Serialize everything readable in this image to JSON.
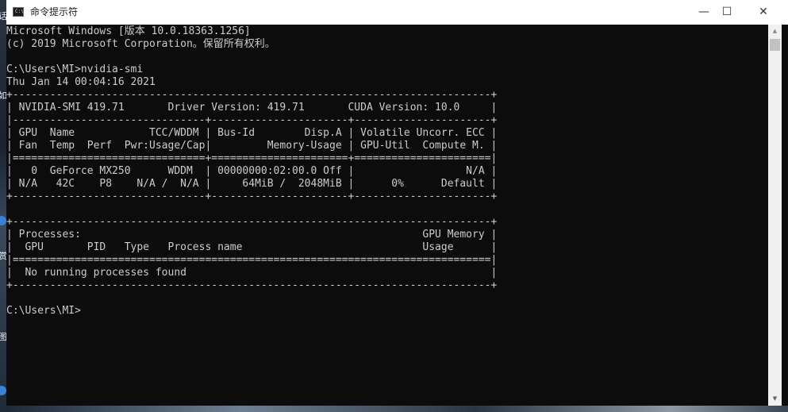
{
  "window": {
    "title": "命令提示符",
    "icon": "cmd-icon",
    "icon_glyph": "C:\\_",
    "controls": {
      "minimize": "—",
      "maximize": "☐",
      "close": "✕"
    }
  },
  "desktop": {
    "glyphs": [
      "话",
      "如",
      "赏",
      "图"
    ]
  },
  "terminal": {
    "lines": [
      "Microsoft Windows [版本 10.0.18363.1256]",
      "(c) 2019 Microsoft Corporation。保留所有权利。",
      "",
      "C:\\Users\\MI>nvidia-smi",
      "Thu Jan 14 00:04:16 2021",
      "+-----------------------------------------------------------------------------+",
      "| NVIDIA-SMI 419.71       Driver Version: 419.71       CUDA Version: 10.0     |",
      "|-------------------------------+----------------------+----------------------+",
      "| GPU  Name            TCC/WDDM | Bus-Id        Disp.A | Volatile Uncorr. ECC |",
      "| Fan  Temp  Perf  Pwr:Usage/Cap|         Memory-Usage | GPU-Util  Compute M. |",
      "|===============================+======================+======================|",
      "|   0  GeForce MX250      WDDM  | 00000000:02:00.0 Off |                  N/A |",
      "| N/A   42C    P8    N/A /  N/A |     64MiB /  2048MiB |      0%      Default |",
      "+-------------------------------+----------------------+----------------------+",
      "",
      "+-----------------------------------------------------------------------------+",
      "| Processes:                                                       GPU Memory |",
      "|  GPU       PID   Type   Process name                             Usage      |",
      "|=============================================================================|",
      "|  No running processes found                                                 |",
      "+-----------------------------------------------------------------------------+",
      "",
      "C:\\Users\\MI>"
    ]
  },
  "scrollbar": {
    "up_arrow": "▲",
    "down_arrow": "▼"
  }
}
